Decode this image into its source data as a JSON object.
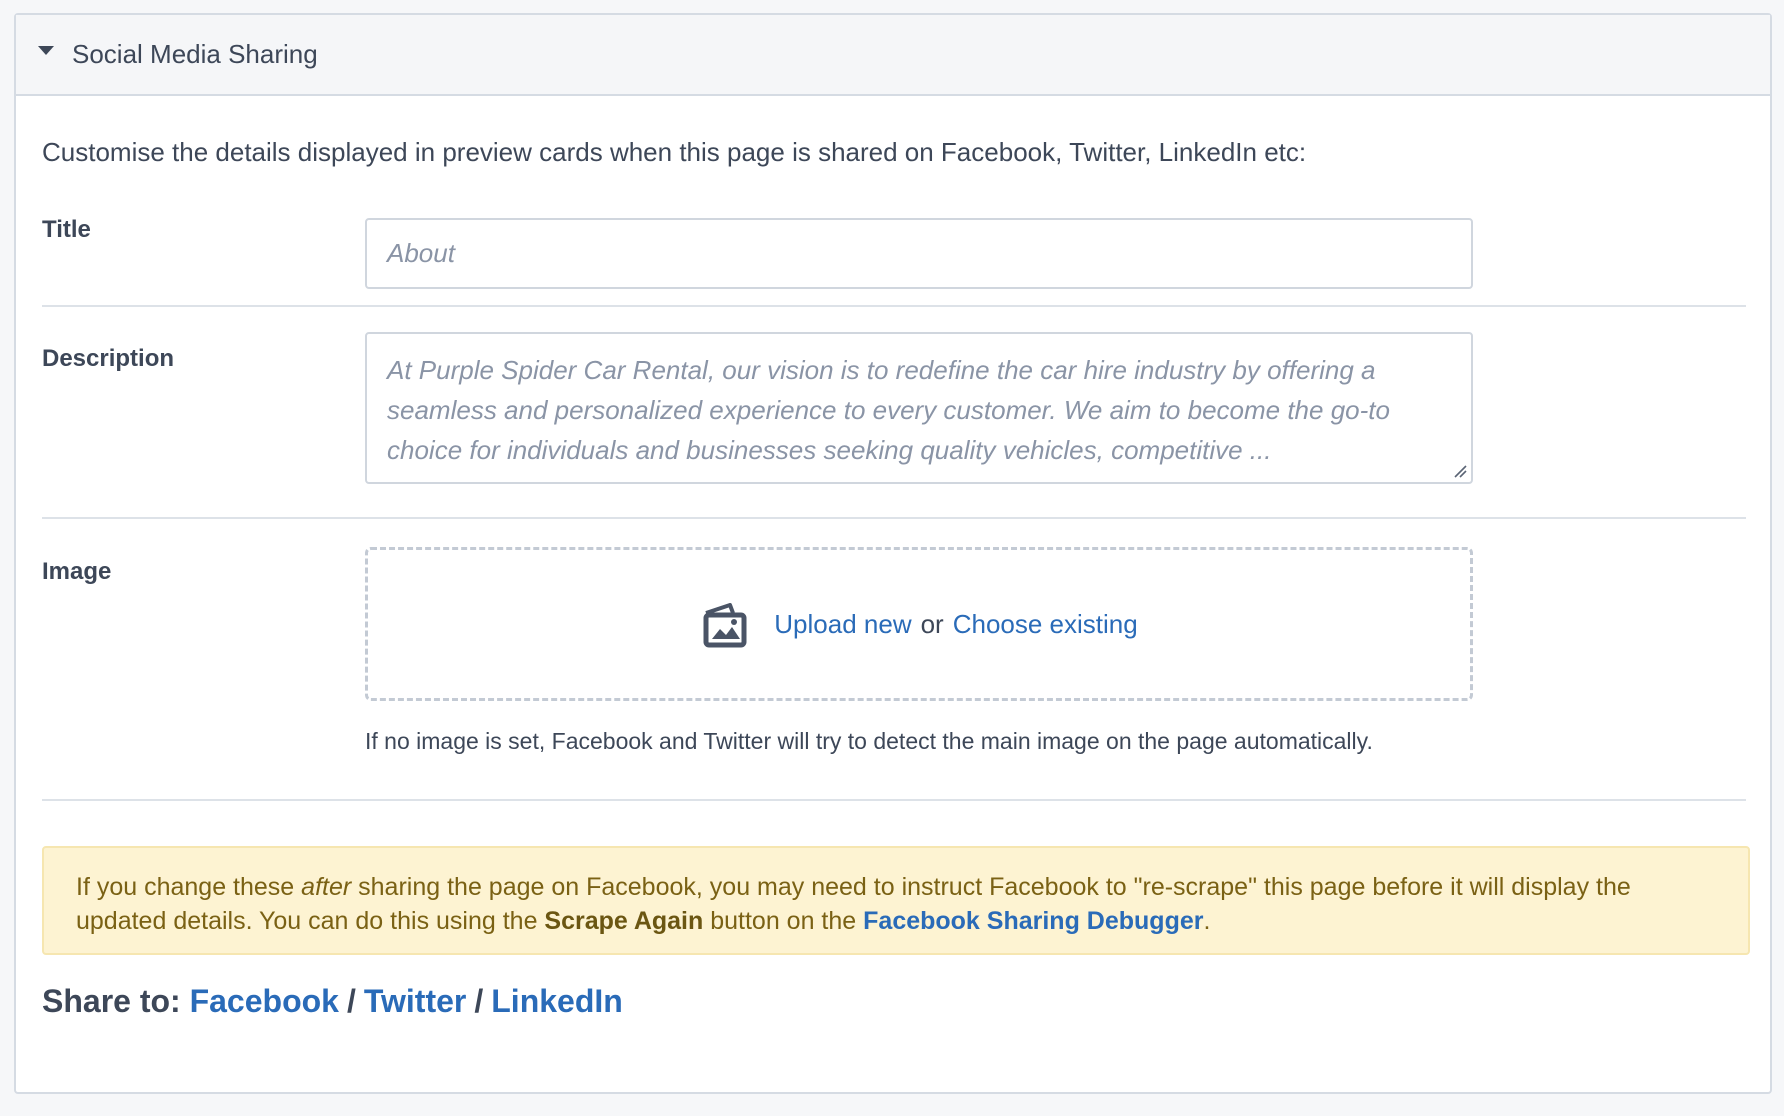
{
  "panel": {
    "title": "Social Media Sharing",
    "intro": "Customise the details displayed in preview cards when this page is shared on Facebook, Twitter, LinkedIn etc:"
  },
  "fields": {
    "title_label": "Title",
    "title_placeholder": "About",
    "description_label": "Description",
    "description_placeholder": "At Purple Spider Car Rental, our vision is to redefine the car hire industry by offering a seamless and personalized experience to every customer. We aim to become the go-to choice for individuals and businesses seeking quality vehicles, competitive ...",
    "image_label": "Image",
    "upload_link": "Upload new",
    "or_text": "or",
    "choose_link": "Choose existing",
    "image_hint": "If no image is set, Facebook and Twitter will try to detect the main image on the page automatically."
  },
  "notice": {
    "part1": "If you change these ",
    "emphasis": "after",
    "part2": " sharing the page on Facebook, you may need to instruct Facebook to \"re-scrape\" this page before it will display the updated details. You can do this using the ",
    "bold": "Scrape Again",
    "part3": " button on the ",
    "link": "Facebook Sharing Debugger",
    "part4": "."
  },
  "share": {
    "label": "Share to:",
    "facebook": "Facebook",
    "twitter": "Twitter",
    "linkedin": "LinkedIn",
    "separator": "/"
  },
  "colors": {
    "link": "#2a6bb8",
    "notice_bg": "#fdf3d2",
    "text": "#3d4758"
  }
}
